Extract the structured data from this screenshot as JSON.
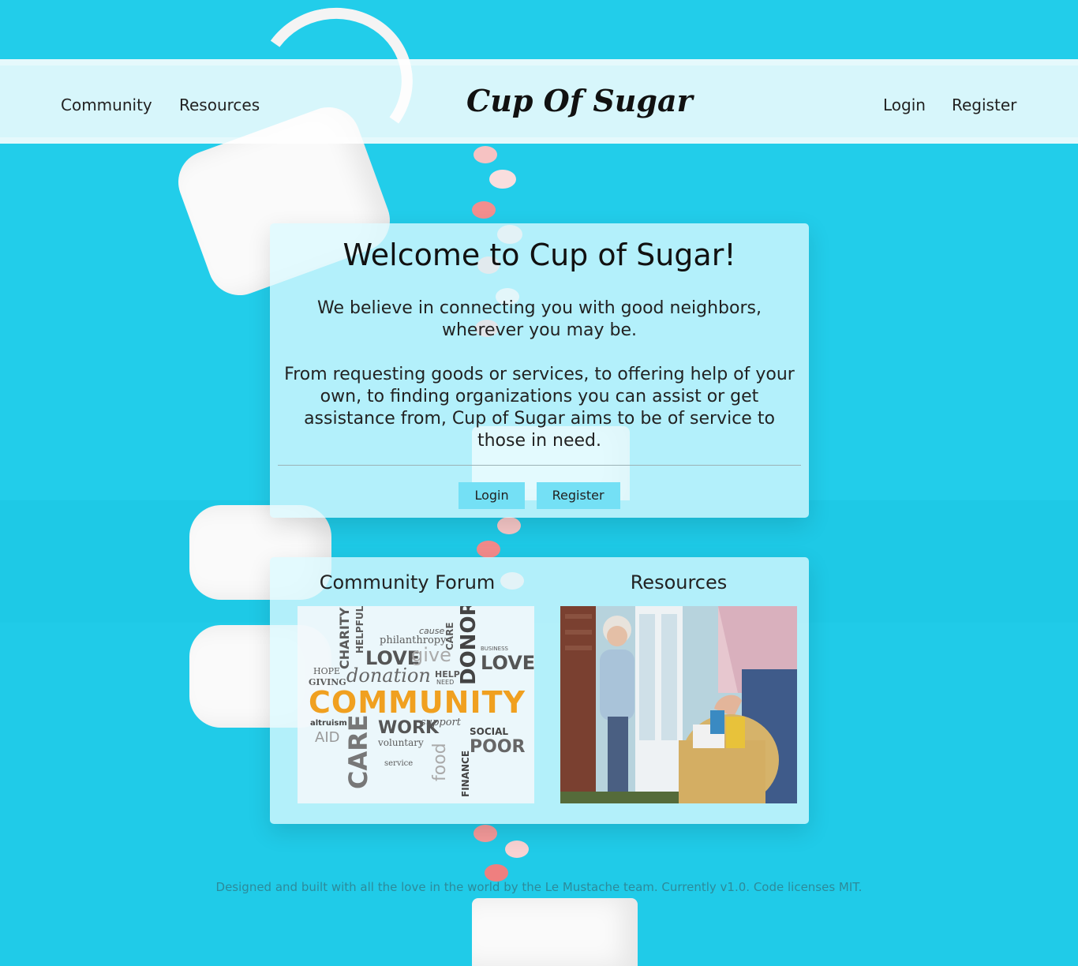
{
  "nav": {
    "community": "Community",
    "resources": "Resources",
    "brand": "Cup Of Sugar",
    "login": "Login",
    "register": "Register"
  },
  "welcome": {
    "title": "Welcome to Cup of Sugar!",
    "intro": "We believe in connecting you with good neighbors, wherever you may be.",
    "body": "From requesting goods or services, to offering help of your own, to finding organizations you can assist or get assistance from, Cup of Sugar aims to be of service to those in need.",
    "login_button": "Login",
    "register_button": "Register"
  },
  "sections": {
    "community_title": "Community Forum",
    "resources_title": "Resources",
    "wordcloud": {
      "main": "COMMUNITY",
      "words": [
        "CHARITY",
        "HELPFUL",
        "philanthropy",
        "cause",
        "CARE",
        "DONOR",
        "LOVE",
        "give",
        "HOPE",
        "GIVING",
        "donation",
        "HELP",
        "NEED",
        "LOVE",
        "BUSINESS",
        "altruism",
        "AID",
        "CARE",
        "WORK",
        "support",
        "SOCIAL",
        "voluntary",
        "food",
        "POOR",
        "FINANCE",
        "service"
      ]
    }
  },
  "footer": {
    "text": "Designed and built with all the love in the world by the Le Mustache team. Currently v1.0. Code licenses MIT."
  },
  "colors": {
    "background": "#1fcbe8",
    "button": "#74e0f5",
    "accent_orange": "#f0a020"
  }
}
